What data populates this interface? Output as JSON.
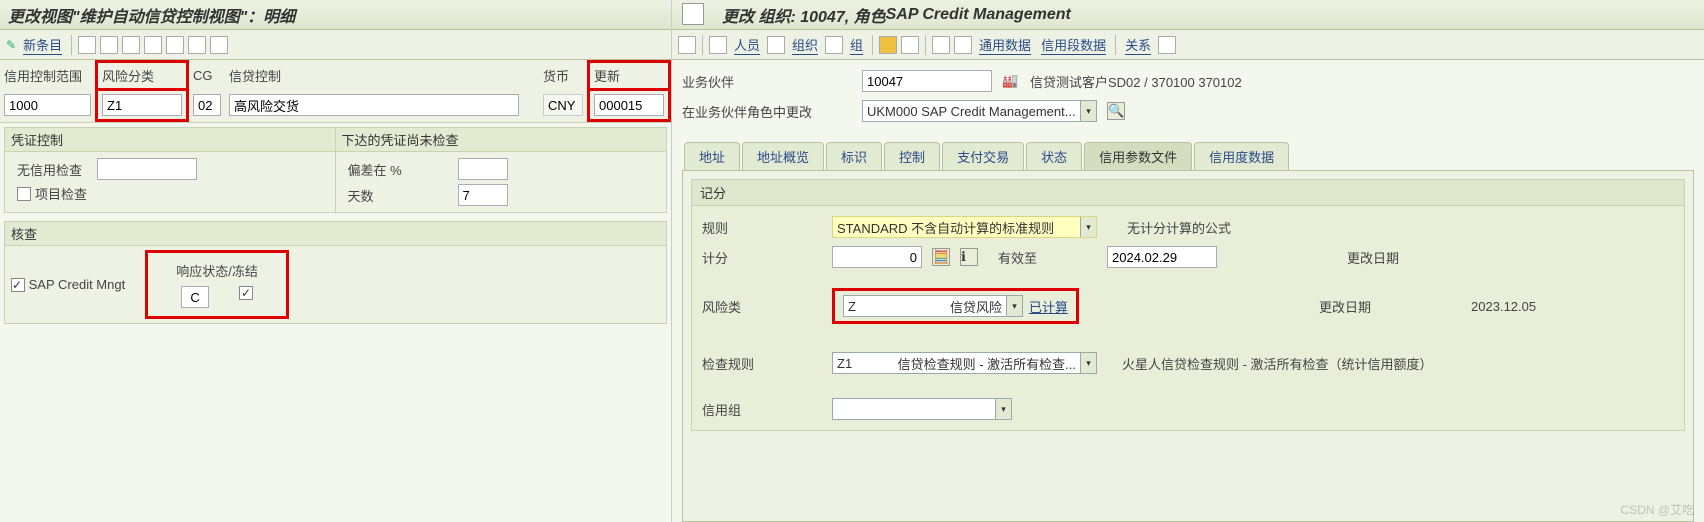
{
  "left": {
    "title": "更改视图\"维护自动信贷控制视图\"：明细",
    "toolbar": {
      "new_entry": "新条目"
    },
    "headers": {
      "credit_ctrl_area": "信用控制范围",
      "risk_class": "风险分类",
      "cg": "CG",
      "credit_ctrl": "信贷控制",
      "currency": "货币",
      "update": "更新"
    },
    "values": {
      "credit_ctrl_area": "1000",
      "risk_class": "Z1",
      "cg": "02",
      "credit_ctrl": "高风险交货",
      "currency": "CNY",
      "update": "000015"
    },
    "group1": {
      "title1": "凭证控制",
      "title2": "下达的凭证尚未检查",
      "no_credit_check": "无信用检查",
      "item_check": "项目检查",
      "deviation": "偏差在 %",
      "days": "天数",
      "days_val": "7"
    },
    "group2": {
      "title": "核查",
      "response_title": "响应状态/冻结",
      "sap_credit_mngt": "SAP Credit Mngt",
      "response_val": "C"
    }
  },
  "right": {
    "title_a": "更改 组织: 10047, 角色 ",
    "title_b": "SAP Credit Management",
    "toolbar": {
      "person": "人员",
      "org": "组织",
      "group": "组",
      "general_data": "通用数据",
      "credit_segment": "信用段数据",
      "relations": "关系"
    },
    "form": {
      "bp_label": "业务伙伴",
      "bp_value": "10047",
      "bp_desc": "信贷测试客户SD02 / 370100 370102",
      "role_label": "在业务伙伴角色中更改",
      "role_value": "UKM000 SAP Credit Management..."
    },
    "tabs": {
      "t1": "地址",
      "t2": "地址概览",
      "t3": "标识",
      "t4": "控制",
      "t5": "支付交易",
      "t6": "状态",
      "t7": "信用参数文件",
      "t8": "信用度数据"
    },
    "scoring": {
      "section": "记分",
      "rule_label": "规则",
      "rule_value": "STANDARD 不含自动计算的标准规则",
      "formula_label": "无计分计算的公式",
      "score_label": "计分",
      "score_value": "0",
      "valid_to_label": "有效至",
      "valid_to_value": "2024.02.29",
      "changed_on1": "更改日期",
      "risk_label": "风险类",
      "risk_code": "Z",
      "risk_desc": "信贷风险",
      "computed": "已计算",
      "changed_on2": "更改日期",
      "changed_on2_val": "2023.12.05",
      "check_rule_label": "检查规则",
      "check_rule_code": "Z1",
      "check_rule_desc": "信贷检查规则 - 激活所有检查...",
      "check_rule_full": "火星人信贷检查规则 - 激活所有检查（统计信用额度）",
      "credit_group_label": "信用组"
    }
  },
  "watermark": "CSDN @艾吃"
}
